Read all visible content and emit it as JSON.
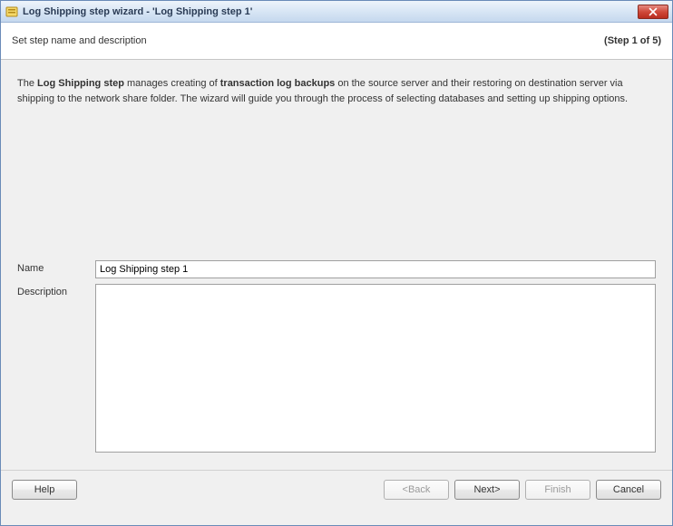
{
  "titlebar": {
    "title": "Log Shipping step wizard - 'Log Shipping step 1'"
  },
  "header": {
    "subtitle": "Set step name and description",
    "step_indicator": "(Step 1 of 5)"
  },
  "intro": {
    "pre": "The ",
    "bold1": "Log Shipping step",
    "mid1": " manages creating of ",
    "bold2": "transaction log backups",
    "rest": " on the source server and their restoring on destination server via shipping to the network share folder. The wizard will guide you through the process of selecting databases and setting up shipping options."
  },
  "form": {
    "name_label": "Name",
    "name_value": "Log Shipping step 1",
    "description_label": "Description",
    "description_value": ""
  },
  "buttons": {
    "help": "Help",
    "back": "<Back",
    "next": "Next>",
    "finish": "Finish",
    "cancel": "Cancel"
  }
}
